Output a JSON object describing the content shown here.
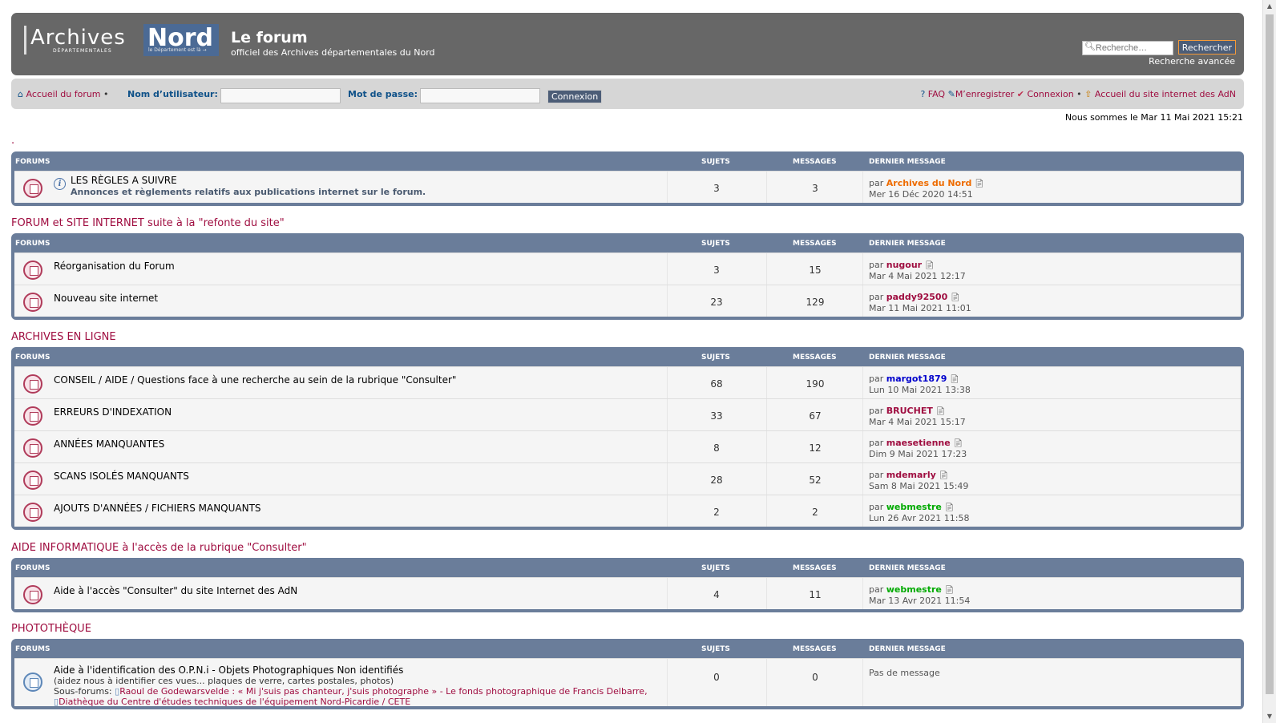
{
  "header": {
    "logo_text": "Archives",
    "logo_sub": "DÉPARTEMENTALES",
    "logo_nord": "Nord",
    "logo_tagline": "le Département est là →",
    "title": "Le forum",
    "subtitle": "officiel des Archives départementales du Nord",
    "search_placeholder": "Recherche…",
    "search_button": "Rechercher",
    "advanced_search": "Recherche avancée"
  },
  "navbar": {
    "home": "Accueil du forum",
    "bullet": "•",
    "username_label": "Nom d’utilisateur:",
    "password_label": "Mot de passe:",
    "login_button": "Connexion",
    "faq": "FAQ",
    "register": "M’enregistrer",
    "login": "Connexion",
    "site_home": "Accueil du site internet des AdN"
  },
  "date_text": "Nous sommes le Mar 11 Mai 2021 15:21",
  "colors": {
    "category_bg": "#6a7d9a",
    "header_bg": "#676767",
    "link_red": "#9f0d40",
    "user_orange": "#ee6c00",
    "user_blue": "#0000cc",
    "user_green": "#00aa00"
  },
  "col_headers": {
    "forums": "FORUMS",
    "topics": "SUJETS",
    "posts": "MESSAGES",
    "last": "DERNIER MESSAGE"
  },
  "last_by": "par",
  "categories": [
    {
      "title": ".",
      "forums": [
        {
          "title": "LES RÈGLES A SUIVRE",
          "desc": "Annonces et règlements relatifs aux publications internet sur le forum.",
          "topics": "3",
          "posts": "3",
          "user": "Archives du Nord",
          "date": "Mer 16 Déc 2020 14:51"
        }
      ]
    },
    {
      "title": "FORUM et SITE INTERNET suite à la \"refonte du site\"",
      "forums": [
        {
          "title": "Réorganisation du Forum",
          "topics": "3",
          "posts": "15",
          "user": "nugour",
          "date": "Mar 4 Mai 2021 12:17"
        },
        {
          "title": "Nouveau site internet",
          "topics": "23",
          "posts": "129",
          "user": "paddy92500",
          "date": "Mar 11 Mai 2021 11:01"
        }
      ]
    },
    {
      "title": "ARCHIVES EN LIGNE",
      "forums": [
        {
          "title": "CONSEIL / AIDE / Questions face à une recherche au sein de la rubrique \"Consulter\"",
          "topics": "68",
          "posts": "190",
          "user": "margot1879",
          "date": "Lun 10 Mai 2021 13:38"
        },
        {
          "title": "ERREURS D'INDEXATION",
          "topics": "33",
          "posts": "67",
          "user": "BRUCHET",
          "date": "Mar 4 Mai 2021 15:17"
        },
        {
          "title": "ANNÉES MANQUANTES",
          "topics": "8",
          "posts": "12",
          "user": "maesetienne",
          "date": "Dim 9 Mai 2021 17:23"
        },
        {
          "title": "SCANS ISOLÉS MANQUANTS",
          "topics": "28",
          "posts": "52",
          "user": "mdemarly",
          "date": "Sam 8 Mai 2021 15:49"
        },
        {
          "title": "AJOUTS D'ANNÉES / FICHIERS MANQUANTS",
          "topics": "2",
          "posts": "2",
          "user": "webmestre",
          "date": "Lun 26 Avr 2021 11:58"
        }
      ]
    },
    {
      "title": "AIDE INFORMATIQUE à l'accès de la rubrique \"Consulter\"",
      "forums": [
        {
          "title": "Aide à l'accès \"Consulter\" du site Internet des AdN",
          "topics": "4",
          "posts": "11",
          "user": "webmestre",
          "date": "Mar 13 Avr 2021 11:54"
        }
      ]
    },
    {
      "title": "PHOTOTHÈQUE",
      "forums": [
        {
          "title": "Aide à l'identification des O.P.N.i - Objets Photographiques Non identifiés",
          "desc": "(aidez nous à identifier ces vues... plaques de verre, cartes postales, photos)",
          "subforums_label": "Sous-forums:",
          "subforum1": "Raoul de Godewarsvelde : « Mi j'suis pas chanteur, j'suis photographe » - Le fonds photographique de Francis Delbarre,",
          "subforum2": "Diathèque du Centre d'études techniques de l'équipement Nord-Picardie / CETE",
          "topics": "0",
          "posts": "0",
          "no_message": "Pas de message"
        }
      ]
    }
  ]
}
